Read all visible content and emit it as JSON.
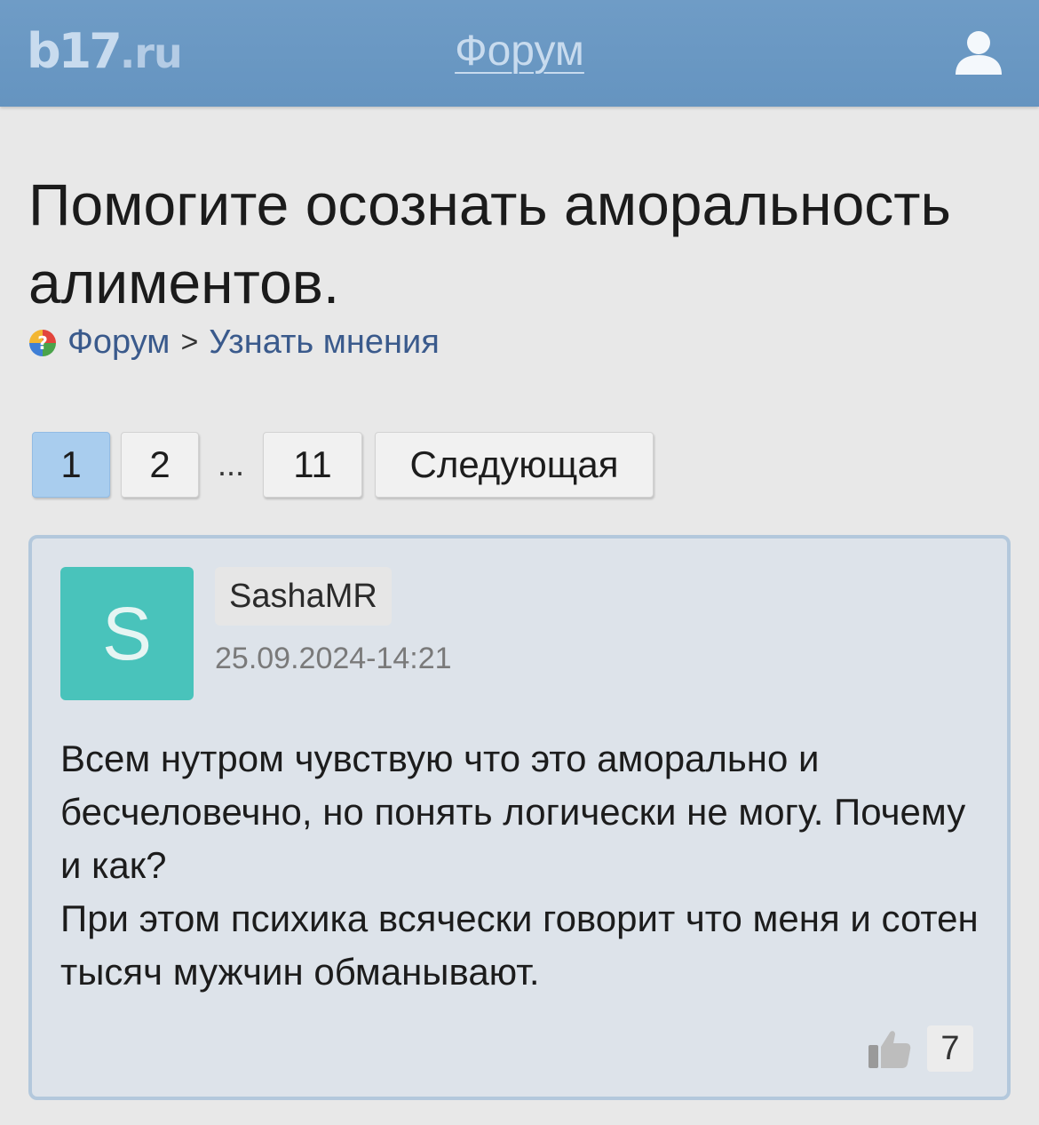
{
  "header": {
    "logo_main": "b17",
    "logo_suffix": ".ru",
    "title": "Форум",
    "user_icon": "user-icon"
  },
  "topic": {
    "title": "Помогите осознать аморальность алиментов."
  },
  "breadcrumb": {
    "icon": "question-icon",
    "items": [
      "Форум",
      "Узнать мнения"
    ],
    "separator": ">"
  },
  "pagination": {
    "pages": [
      "1",
      "2",
      "11"
    ],
    "ellipsis": "...",
    "active": "1",
    "next_label": "Следующая"
  },
  "post": {
    "avatar_letter": "S",
    "author": "SashaMR",
    "date": "25.09.2024-14:21",
    "lines": [
      "Всем нутром чувствую что это аморально и бесчеловечно, но понять логически не могу. Почему и как?",
      "При этом психика всячески говорит что меня и сотен тысяч мужчин обманывают."
    ],
    "like_icon": "thumbs-up-icon",
    "likes": "7"
  },
  "colors": {
    "header": "#6a98c4",
    "avatar": "#49c3bb",
    "active_page": "#a9cdee",
    "post_border": "#b3c8dc",
    "link": "#3a5a8c"
  }
}
